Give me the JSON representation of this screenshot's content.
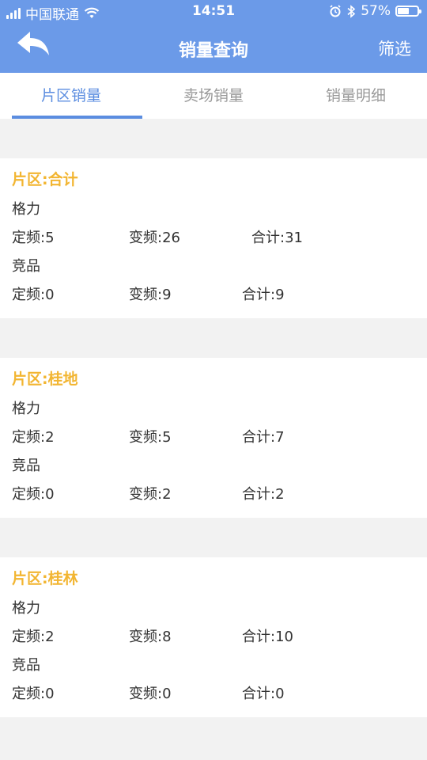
{
  "status_bar": {
    "carrier": "中国联通",
    "time": "14:51",
    "battery": "57%",
    "battery_level": 0.57
  },
  "nav": {
    "title": "销量查询",
    "filter_label": "筛选"
  },
  "tabs": [
    {
      "label": "片区销量",
      "active": true
    },
    {
      "label": "卖场销量",
      "active": false
    },
    {
      "label": "销量明细",
      "active": false
    }
  ],
  "cards": [
    {
      "title": "片区:合计",
      "groups": [
        {
          "label": "格力",
          "fixed": "定频:5",
          "variable": "变频:26",
          "total": "合计:31"
        },
        {
          "label": "竞品",
          "fixed": "定频:0",
          "variable": "变频:9",
          "total": "合计:9"
        }
      ]
    },
    {
      "title": "片区:桂地",
      "groups": [
        {
          "label": "格力",
          "fixed": "定频:2",
          "variable": "变频:5",
          "total": "合计:7"
        },
        {
          "label": "竞品",
          "fixed": "定频:0",
          "variable": "变频:2",
          "total": "合计:2"
        }
      ]
    },
    {
      "title": "片区:桂林",
      "groups": [
        {
          "label": "格力",
          "fixed": "定频:2",
          "variable": "变频:8",
          "total": "合计:10"
        },
        {
          "label": "竞品",
          "fixed": "定频:0",
          "variable": "变频:0",
          "total": "合计:0"
        }
      ]
    }
  ]
}
